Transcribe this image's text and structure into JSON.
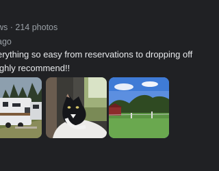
{
  "review": {
    "meta": "ws · 214 photos",
    "time": "ago",
    "text_line1": "erything so easy from reservations to dropping off",
    "text_line2": "ighly recommend!!"
  },
  "photos": [
    {
      "subject": "rv-campground"
    },
    {
      "subject": "cat-in-window"
    },
    {
      "subject": "pasture-with-barn"
    }
  ]
}
